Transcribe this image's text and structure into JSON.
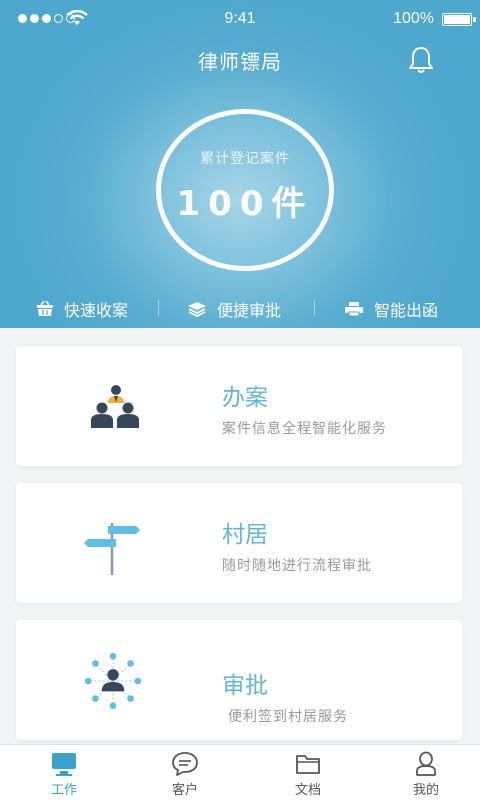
{
  "status_bar": {
    "time": "9:41",
    "battery": "100%"
  },
  "header": {
    "title": "律师镖局",
    "counter": {
      "label": "累计登记案件",
      "value": "100件"
    }
  },
  "quick_actions": [
    {
      "label": "快速收案",
      "icon": "basket-icon"
    },
    {
      "label": "便捷审批",
      "icon": "layers-icon"
    },
    {
      "label": "智能出函",
      "icon": "printer-icon"
    }
  ],
  "cards": [
    {
      "title": "办案",
      "subtitle": "案件信息全程智能化服务",
      "icon": "team-icon"
    },
    {
      "title": "村居",
      "subtitle": "随时随地进行流程审批",
      "icon": "signpost-icon"
    },
    {
      "title": "审批",
      "subtitle": "便利签到村居服务",
      "icon": "network-icon"
    }
  ],
  "tabbar": [
    {
      "label": "工作",
      "icon": "monitor-icon",
      "active": true
    },
    {
      "label": "客户",
      "icon": "chat-icon",
      "active": false
    },
    {
      "label": "文档",
      "icon": "folder-icon",
      "active": false
    },
    {
      "label": "我的",
      "icon": "user-icon",
      "active": false
    }
  ],
  "colors": {
    "primary": "#4ea7cd",
    "card_title": "#66b5d5",
    "active_tab": "#3da0cc",
    "icon_dark": "#37475a",
    "icon_light": "#62bde4"
  }
}
